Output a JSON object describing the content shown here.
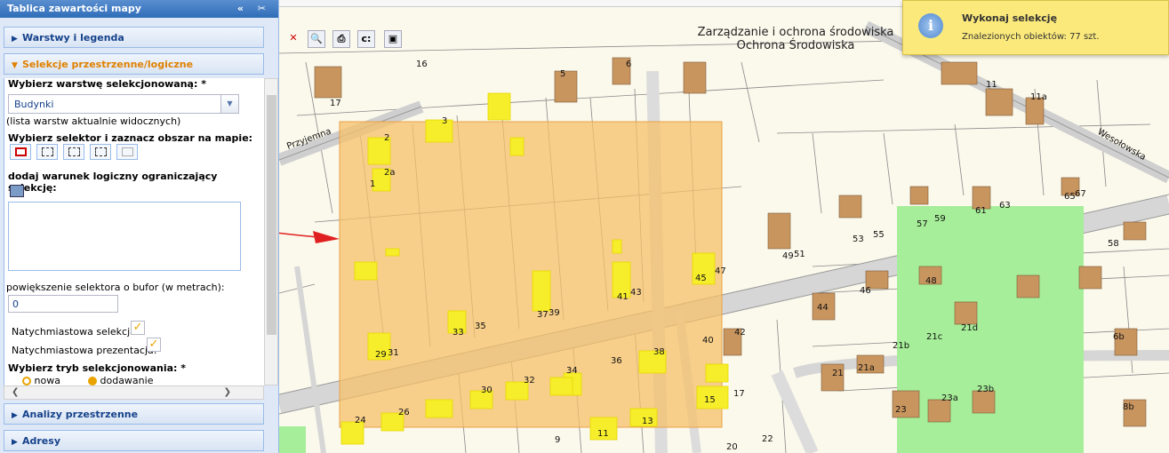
{
  "panel": {
    "title": "Tablica zawartości mapy",
    "tools": "« ✂",
    "sections": {
      "layers": "Warstwy i legenda",
      "selection": "Selekcje przestrzenne/logiczne",
      "analysis": "Analizy przestrzenne",
      "addresses": "Adresy"
    },
    "selection": {
      "layer_label": "Wybierz warstwę selekcjonowaną: *",
      "layer_value": "Budynki",
      "layer_hint": "(lista warstw aktualnie widocznych)",
      "selector_label": "Wybierz selektor i zaznacz obszar na mapie:",
      "condition_label": "dodaj warunek logiczny ograniczający selekcję:",
      "buffer_label": "powiększenie selektora o bufor (w metrach):",
      "buffer_value": "0",
      "instant_selection_label": "Natychmiastowa selekcja:",
      "instant_presentation_label": "Natychmiastowa prezentacja:",
      "mode_label": "Wybierz tryb selekcjonowania: *",
      "mode_new": "nowa",
      "mode_add": "dodawanie"
    }
  },
  "map": {
    "title_line1": "Zarządzanie i ochrona środowiska",
    "title_line2": "Ochrona Środowiska",
    "streets": [
      "Przyjemna",
      "Wesołowska"
    ],
    "house_numbers": [
      "16",
      "5",
      "6",
      "11",
      "11a",
      "17",
      "3",
      "2",
      "2a",
      "1",
      "65",
      "67",
      "61",
      "63",
      "57",
      "59",
      "53",
      "55",
      "49",
      "51",
      "47",
      "45",
      "41",
      "43",
      "39",
      "37",
      "33",
      "35",
      "29",
      "31",
      "58",
      "48",
      "46",
      "44",
      "42",
      "40",
      "38",
      "36",
      "34",
      "32",
      "30",
      "26",
      "24",
      "21",
      "21a",
      "21b",
      "21c",
      "21d",
      "23",
      "23a",
      "23b",
      "6b",
      "8b",
      "17",
      "15",
      "13",
      "11",
      "9",
      "22",
      "20"
    ],
    "toolbar_icons": [
      "close-icon",
      "zoom-icon",
      "print-icon",
      "cursor-icon",
      "image-icon"
    ]
  },
  "toast": {
    "title": "Wykonaj selekcję",
    "message": "Znalezionych obiektów: 77 szt."
  },
  "colors": {
    "selection_fill": "#f5c06a",
    "selected_building": "#f6ee2a",
    "building": "#c9955f",
    "green_area": "#a6ee99",
    "road": "#d9d9d9",
    "arrow": "#e02020"
  }
}
